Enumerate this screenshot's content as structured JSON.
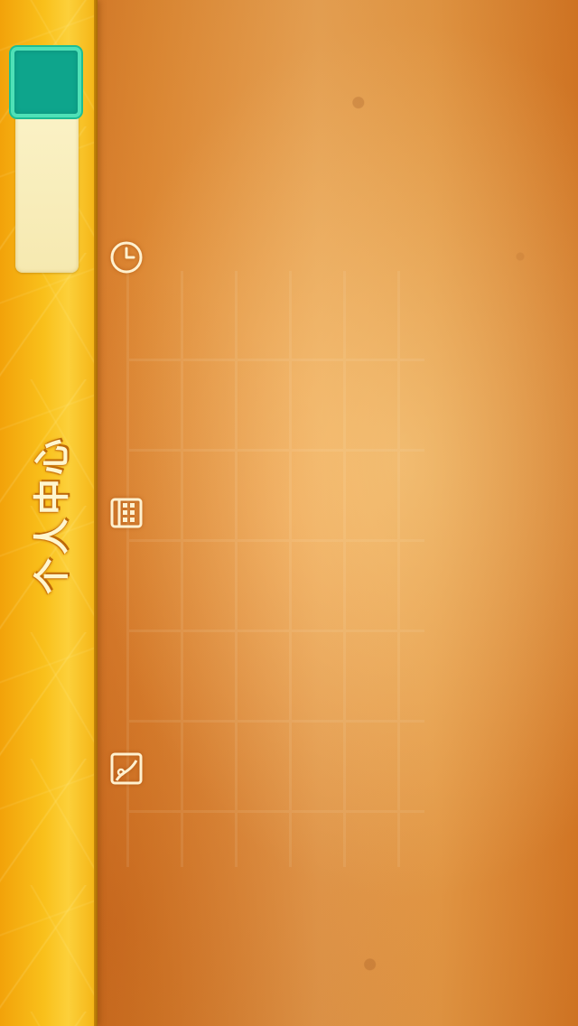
{
  "sidebar": {
    "title": "个人中心",
    "avatar_color": "#0ea58c",
    "avatar_border_color": "#4fe1b7"
  },
  "toolbar": {
    "icons": [
      {
        "name": "clock-icon",
        "purpose": "history"
      },
      {
        "name": "calendar-icon",
        "purpose": "schedule"
      },
      {
        "name": "image-icon",
        "purpose": "photos"
      }
    ]
  },
  "theme": {
    "background": "#e58a30",
    "sidebar": "#f9c01b",
    "icon_color": "#fff1cf"
  }
}
